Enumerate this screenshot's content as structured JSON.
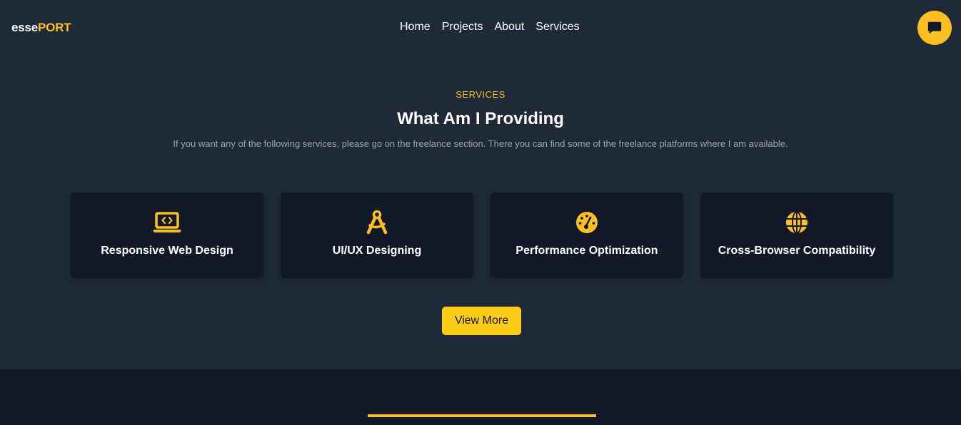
{
  "header": {
    "logo_part1": "esse",
    "logo_part2": "PORT",
    "nav": [
      "Home",
      "Projects",
      "About",
      "Services"
    ],
    "chat_icon": "chat-bubble-icon"
  },
  "services": {
    "eyebrow": "SERVICES",
    "title": "What Am I Providing",
    "description": "If you want any of the following services, please go on the freelance section. There you can find some of the freelance platforms where I am available.",
    "cards": [
      {
        "icon": "laptop-code-icon",
        "label": "Responsive Web Design"
      },
      {
        "icon": "compass-drafting-icon",
        "label": "UI/UX Designing"
      },
      {
        "icon": "gauge-icon",
        "label": "Performance Optimization"
      },
      {
        "icon": "globe-icon",
        "label": "Cross-Browser Compatibility"
      }
    ],
    "button_label": "View More"
  },
  "colors": {
    "background": "#1f2937",
    "card": "#111827",
    "accent": "#fbbf24",
    "button": "#facc15"
  }
}
